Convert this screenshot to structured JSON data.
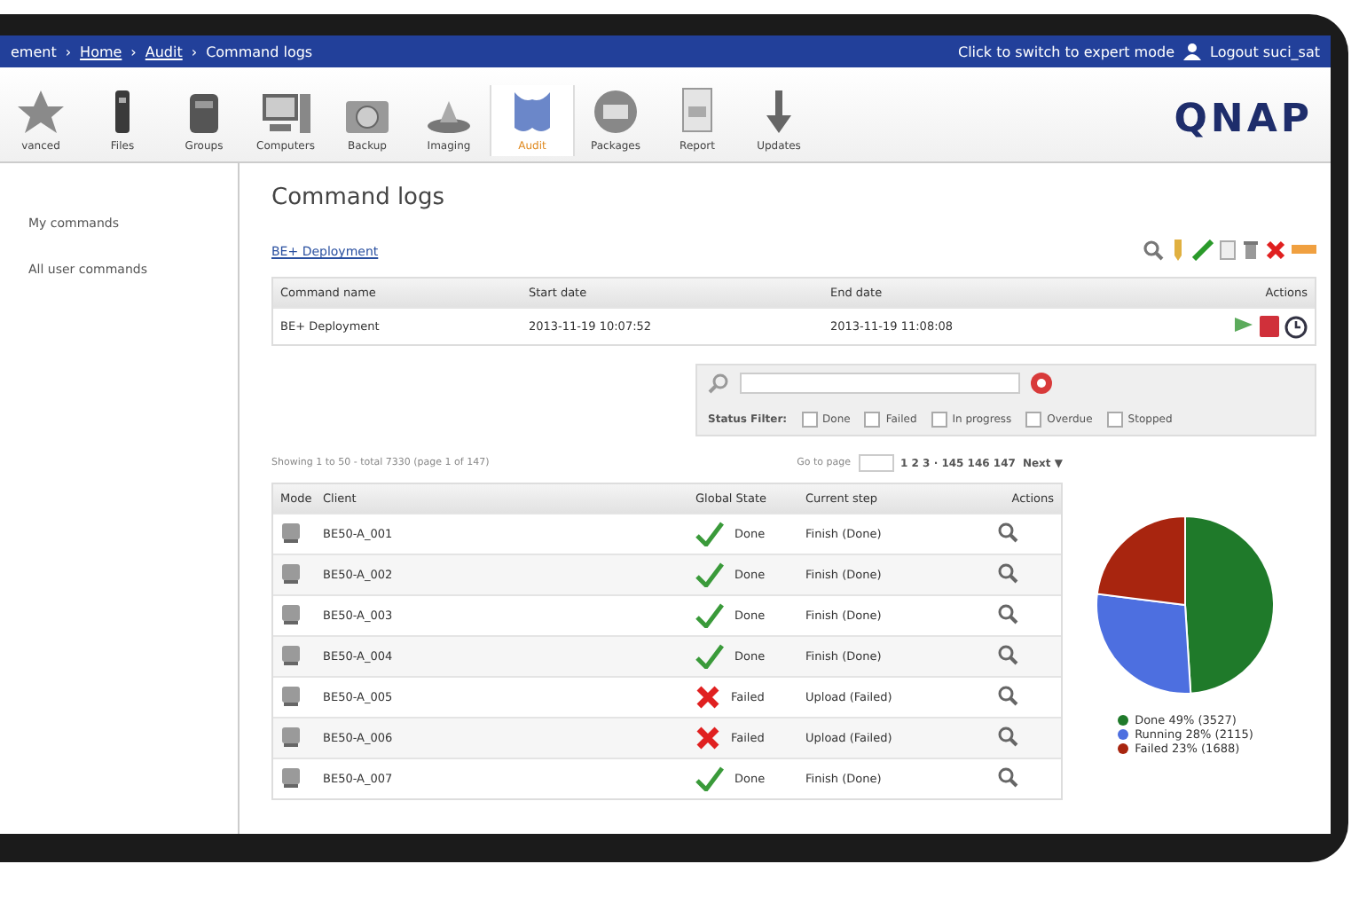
{
  "top_bar": {
    "separator": "›",
    "breadcrumb": [
      "ement",
      "Home",
      "Audit",
      "Command logs"
    ],
    "expert_link": "Click to switch to expert mode",
    "logout": "Logout suci_sat"
  },
  "toolbar": {
    "items": [
      {
        "label": "vanced",
        "selected": false
      },
      {
        "label": "Files",
        "selected": false
      },
      {
        "label": "Groups",
        "selected": false
      },
      {
        "label": "Computers",
        "selected": false
      },
      {
        "label": "Backup",
        "selected": false
      },
      {
        "label": "Imaging",
        "selected": false
      },
      {
        "label": "Audit",
        "selected": true
      },
      {
        "label": "Packages",
        "selected": false
      },
      {
        "label": "Report",
        "selected": false
      },
      {
        "label": "Updates",
        "selected": false
      }
    ],
    "logo": "QNAP"
  },
  "sidebar": {
    "items": [
      {
        "label": "My commands",
        "selected": false
      },
      {
        "label": "All user commands",
        "selected": false
      }
    ]
  },
  "page": {
    "title": "Command logs",
    "link": "BE+ Deployment"
  },
  "commands_table": {
    "columns": [
      "Command name",
      "Start date",
      "End date",
      "Actions"
    ],
    "rows": [
      [
        "BE+ Deployment",
        "2013-11-19 10:07:52",
        "2013-11-19 11:08:08"
      ]
    ]
  },
  "filter": {
    "label": "Status Filter:",
    "options": [
      {
        "label": "Done",
        "checked": false
      },
      {
        "label": "Failed",
        "checked": false
      },
      {
        "label": "In progress",
        "checked": false
      },
      {
        "label": "Overdue",
        "checked": false
      },
      {
        "label": "Stopped",
        "checked": false
      }
    ]
  },
  "pagination": {
    "summary": "Showing 1 to 50 - total 7330 (page 1 of 147)",
    "goto_label": "Go to page",
    "pages": "1 2 3 · 145 146 147",
    "next": "Next ▼"
  },
  "clients_table": {
    "columns": [
      "Mode",
      "Client",
      "Global State",
      "Current step",
      "Actions"
    ],
    "rows": [
      {
        "client": "BE50-A_001",
        "state": "Done",
        "kind": "done",
        "step": "Finish (Done)"
      },
      {
        "client": "BE50-A_002",
        "state": "Done",
        "kind": "done",
        "step": "Finish (Done)"
      },
      {
        "client": "BE50-A_003",
        "state": "Done",
        "kind": "done",
        "step": "Finish (Done)"
      },
      {
        "client": "BE50-A_004",
        "state": "Done",
        "kind": "done",
        "step": "Finish (Done)"
      },
      {
        "client": "BE50-A_005",
        "state": "Failed",
        "kind": "failed",
        "step": "Upload (Failed)"
      },
      {
        "client": "BE50-A_006",
        "state": "Failed",
        "kind": "failed",
        "step": "Upload (Failed)"
      },
      {
        "client": "BE50-A_007",
        "state": "Done",
        "kind": "done",
        "step": "Finish (Done)"
      }
    ]
  },
  "status_chart": {
    "chart_data": {
      "type": "pie",
      "categories": [
        "Done",
        "Running",
        "Failed"
      ],
      "series": [
        {
          "values": [
            49,
            28,
            23
          ]
        }
      ],
      "colors": [
        "#1f7a2a",
        "#4d6fe0",
        "#a8250f"
      ],
      "value_labels": [
        "49%",
        "28%",
        "23%"
      ]
    },
    "legend_counts": [
      "(3527)",
      "(2115)",
      "(1688)"
    ]
  }
}
